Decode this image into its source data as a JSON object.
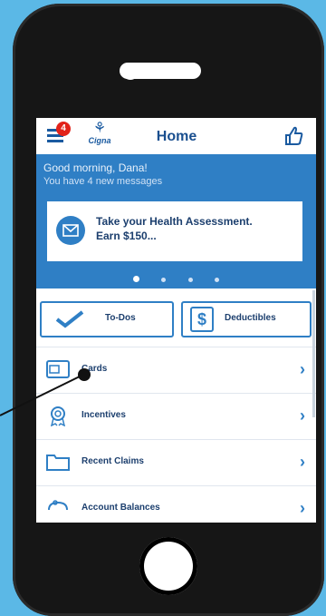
{
  "header": {
    "badge_count": "4",
    "brand_name": "Cigna",
    "title": "Home"
  },
  "banner": {
    "greeting": "Good morning, Dana!",
    "messages": "You have 4 new messages",
    "promo_line1": "Take your Health Assessment.",
    "promo_line2": "Earn $150..."
  },
  "quick_actions": {
    "todos_label": "To-Dos",
    "deductibles_label": "Deductibles"
  },
  "list_items": [
    {
      "label": "Cards",
      "icon": "card-icon"
    },
    {
      "label": "Incentives",
      "icon": "ribbon-icon"
    },
    {
      "label": "Recent Claims",
      "icon": "folder-icon"
    },
    {
      "label": "Account Balances",
      "icon": "piggy-icon"
    }
  ],
  "colors": {
    "background": "#5bb8e6",
    "phone_body": "#161616",
    "brand_blue": "#2f7fc5",
    "badge_red": "#e2231a",
    "text_dark_blue": "#1c3f6e"
  }
}
